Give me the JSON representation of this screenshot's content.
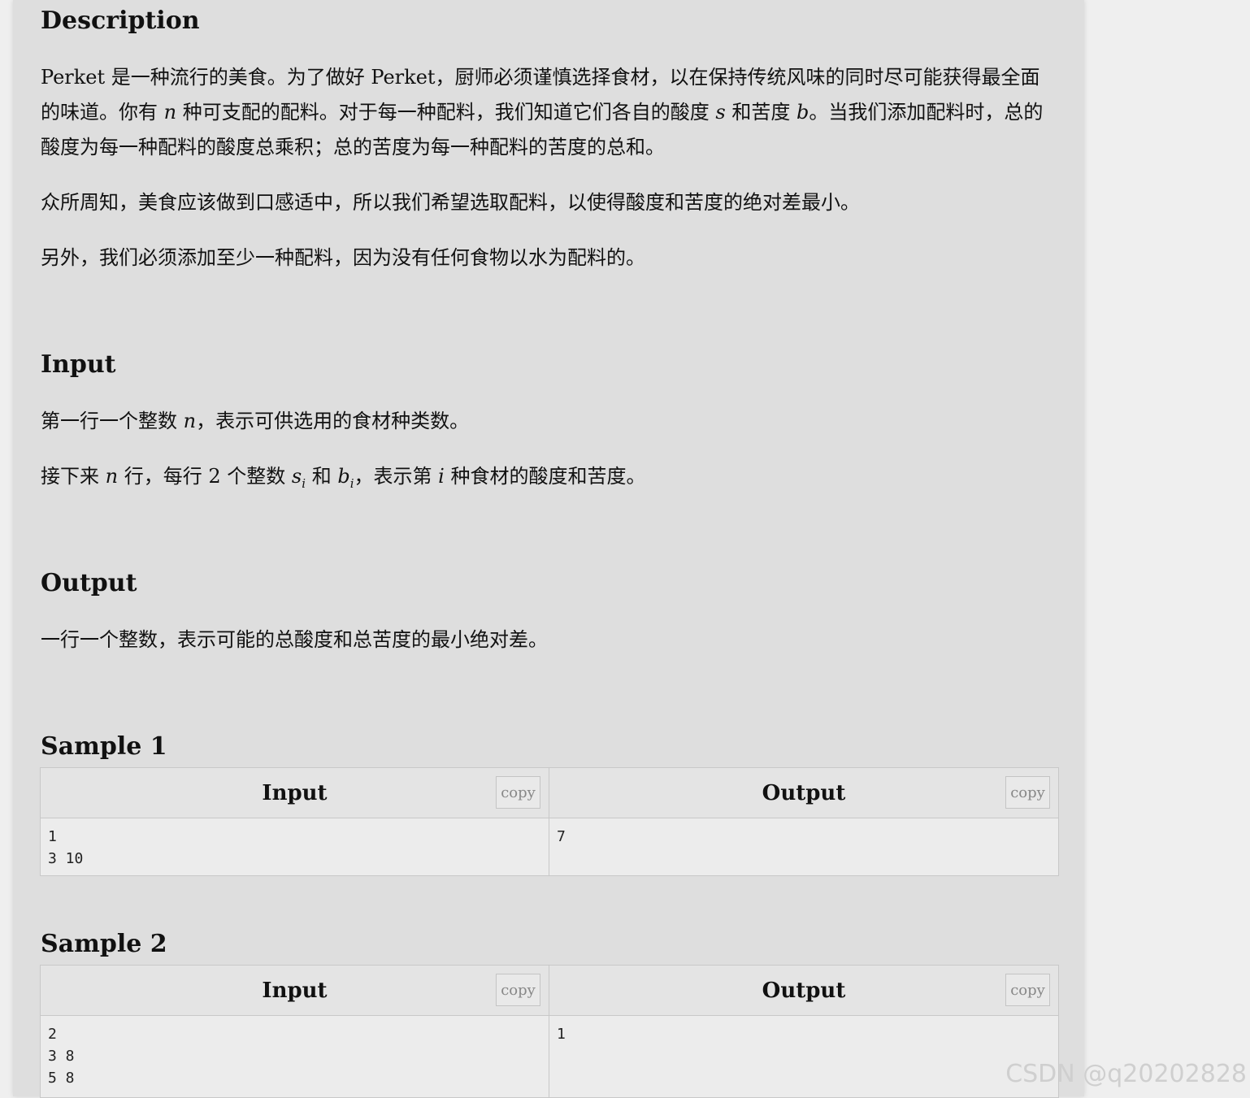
{
  "description": {
    "title": "Description",
    "p1": {
      "a": "Perket",
      "b": " 是一种流行的美食。为了做好 ",
      "c": "Perket",
      "d": "，厨师必须谨慎选择食材，以在保持传统风味的同时尽可能获得最全面的味道。你有 ",
      "var_n": "n",
      "e": " 种可支配的配料。对于每一种配料，我们知道它们各自的酸度 ",
      "var_s": "s",
      "f": " 和苦度 ",
      "var_b": "b",
      "g": "。当我们添加配料时，总的酸度为每一种配料的酸度总乘积；总的苦度为每一种配料的苦度的总和。"
    },
    "p2": "众所周知，美食应该做到口感适中，所以我们希望选取配料，以使得酸度和苦度的绝对差最小。",
    "p3": "另外，我们必须添加至少一种配料，因为没有任何食物以水为配料的。"
  },
  "input_section": {
    "title": "Input",
    "p1": {
      "a": "第一行一个整数 ",
      "var_n": "n",
      "b": "，表示可供选用的食材种类数。"
    },
    "p2": {
      "a": "接下来 ",
      "var_n": "n",
      "b": " 行，每行 ",
      "num": "2",
      "c": " 个整数 ",
      "var_s": "s",
      "sub_i1": "i",
      "d": " 和 ",
      "var_b": "b",
      "sub_i2": "i",
      "e": "，表示第 ",
      "var_i": "i",
      "f": " 种食材的酸度和苦度。"
    }
  },
  "output_section": {
    "title": "Output",
    "p1": "一行一个整数，表示可能的总酸度和总苦度的最小绝对差。"
  },
  "samples": [
    {
      "title": "Sample 1",
      "input_label": "Input",
      "output_label": "Output",
      "copy_label": "copy",
      "input": "1\n3 10",
      "output": "7"
    },
    {
      "title": "Sample 2",
      "input_label": "Input",
      "output_label": "Output",
      "copy_label": "copy",
      "input": "2\n3 8\n5 8",
      "output": "1"
    }
  ],
  "watermark": "CSDN @q20202828"
}
